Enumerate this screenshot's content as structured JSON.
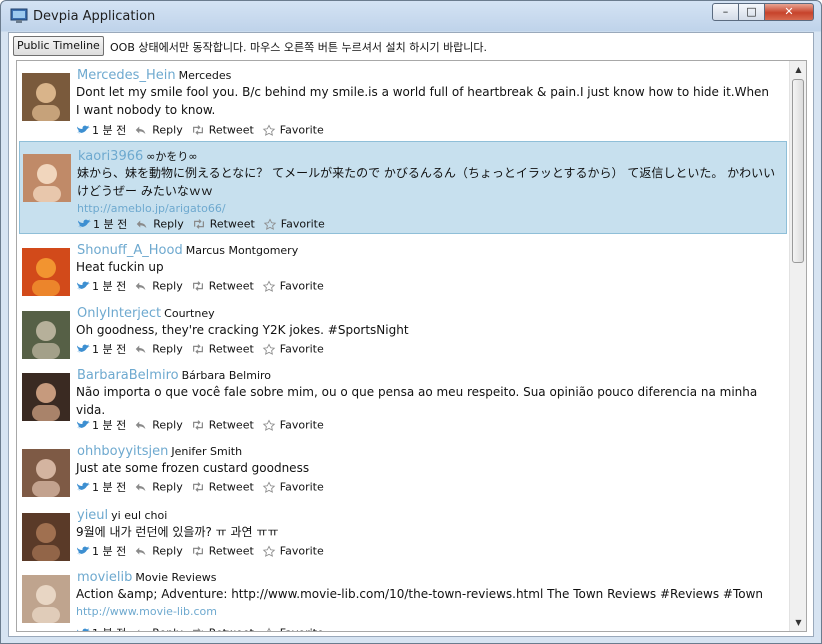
{
  "window": {
    "title": "Devpia Application",
    "controls": {
      "minimize": "–",
      "maximize": "□",
      "close": "✕"
    }
  },
  "toolbar": {
    "button_label": "Public Timeline",
    "status": "OOB 상태에서만 동작합니다. 마우스 오른쪽 버튼 누르셔서 설치 하시기 바랍니다."
  },
  "actions": {
    "time": "1 분 전",
    "reply": "Reply",
    "retweet": "Retweet",
    "favorite": "Favorite"
  },
  "colors": {
    "selected_row": "#c7e0ee",
    "screen_name": "#6ea9cf",
    "bird": "#3d8fd1"
  },
  "tweets": [
    {
      "screen_name": "Mercedes_Hein",
      "real_name": "Mercedes",
      "text": "Dont let my smile fool you. B/c behind my smile.is a world full of heartbreak & pain.I just know how to hide it.When I want nobody to know.",
      "link": ""
    },
    {
      "screen_name": "kaori3966",
      "real_name": "∞かをり∞",
      "text": "妹から、妹を動物に例えるとなに？ てメールが来たので かびるんるん（ちょっとイラッとするから） て返信しといた。 かわいいけどうぜー みたいなｗｗ",
      "link": "http://ameblo.jp/arigato66/",
      "selected": true
    },
    {
      "screen_name": "Shonuff_A_Hood",
      "real_name": "Marcus Montgomery",
      "text": "Heat fuckin up",
      "link": ""
    },
    {
      "screen_name": "OnlyInterject",
      "real_name": "Courtney",
      "text": "Oh goodness, they're cracking Y2K jokes. #SportsNight",
      "link": ""
    },
    {
      "screen_name": "BarbaraBelmiro",
      "real_name": "Bárbara Belmiro",
      "text": "Não importa o que você fale sobre mim, ou o que pensa ao meu respeito. Sua opinião pouco diferencia na minha vida.",
      "link": ""
    },
    {
      "screen_name": "ohhboyyitsjen",
      "real_name": "Jenifer Smith",
      "text": "Just ate some frozen custard goodness",
      "link": ""
    },
    {
      "screen_name": "yieul",
      "real_name": "yi eul choi",
      "text": "9월에 내가 런던에 있을까? ㅠ 과연 ㅠㅠ",
      "link": ""
    },
    {
      "screen_name": "movielib",
      "real_name": "Movie Reviews",
      "text": "Action &amp; Adventure: http://www.movie-lib.com/10/the-town-reviews.html The Town Reviews #Reviews #Town",
      "link": "http://www.movie-lib.com"
    }
  ]
}
